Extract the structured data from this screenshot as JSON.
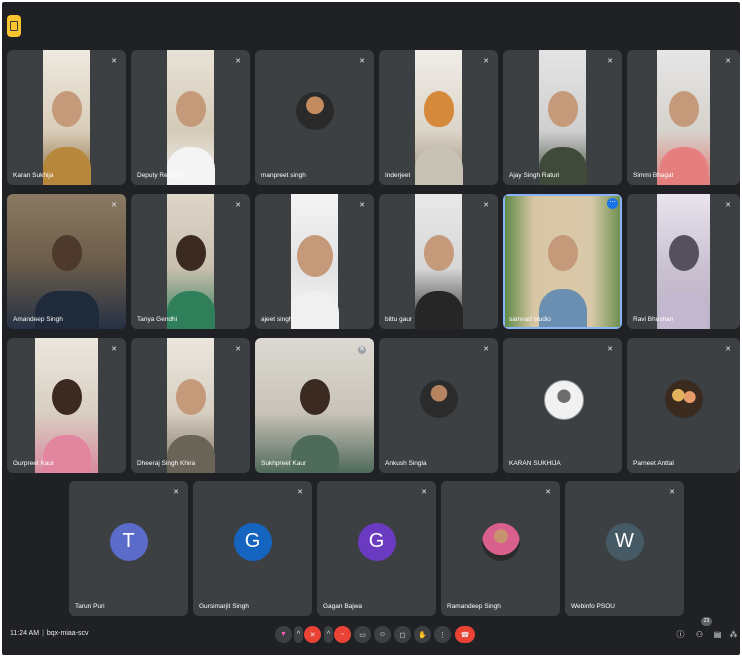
{
  "participants": [
    {
      "name": "Karan Sukhija",
      "mic": "off"
    },
    {
      "name": "Deputy Registrar",
      "mic": "off"
    },
    {
      "name": "manpreet singh",
      "mic": "off"
    },
    {
      "name": "Inderjeet",
      "mic": "off"
    },
    {
      "name": "Ajay Singh Raturi",
      "mic": "off"
    },
    {
      "name": "Simmi Bhagat",
      "mic": "off"
    },
    {
      "name": "Amandeep Singh",
      "mic": "off"
    },
    {
      "name": "Tanya Gendhi",
      "mic": "off"
    },
    {
      "name": "ajeet singh",
      "mic": "off"
    },
    {
      "name": "bittu gaur",
      "mic": "off"
    },
    {
      "name": "samvad studio",
      "mic": "on"
    },
    {
      "name": "Ravi Bhushan",
      "mic": "off"
    },
    {
      "name": "Gurpreet Kaur",
      "mic": "off"
    },
    {
      "name": "Dheeraj Singh Khira",
      "mic": "off"
    },
    {
      "name": "Sukhpreet Kaur",
      "mic": "off"
    },
    {
      "name": "Ankush Singla",
      "mic": "off"
    },
    {
      "name": "KARAN SUKHIJA",
      "mic": "off"
    },
    {
      "name": "Parneet Anttal",
      "mic": "off"
    },
    {
      "name": "Tarun Puri",
      "mic": "off",
      "initial": "T",
      "color": "#5b6bc9"
    },
    {
      "name": "Gursimarjit Singh",
      "mic": "off",
      "initial": "G",
      "color": "#1565c0"
    },
    {
      "name": "Gagan Bajwa",
      "mic": "off",
      "initial": "G",
      "color": "#6a3ac0"
    },
    {
      "name": "Ramandeep Singh",
      "mic": "off"
    },
    {
      "name": "Webinfo PSOU",
      "mic": "off",
      "initial": "W",
      "color": "#455a64"
    }
  ],
  "bottom_bar": {
    "time": "11:24 AM",
    "separator": "|",
    "meeting_code": "bqx-miaa-scv",
    "participant_count": "23"
  },
  "icons": {
    "mic_off": "mic-off-icon",
    "more": "more-options-icon",
    "hangup": "hangup-icon",
    "info": "info-icon",
    "people": "people-icon",
    "chat": "chat-icon",
    "activities": "activities-icon"
  },
  "colors": {
    "background": "#202124",
    "tile": "#3c4043",
    "accent_red": "#ea4335",
    "active_outline": "#8ab4f8",
    "badge_yellow": "#f9c52f"
  }
}
